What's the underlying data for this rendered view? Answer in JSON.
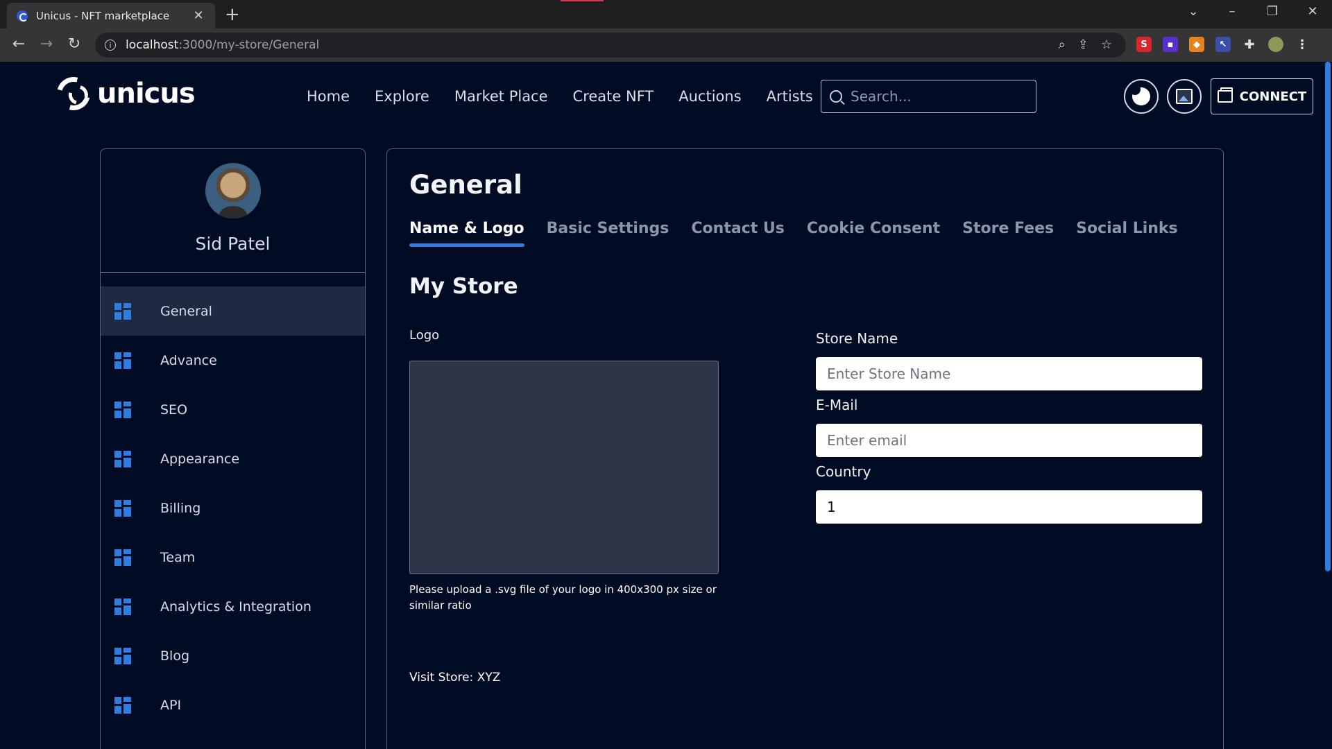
{
  "browser": {
    "tab_title": "Unicus - NFT marketplace",
    "url_host": "localhost",
    "url_path": ":3000/my-store/General"
  },
  "header": {
    "brand": "unicus",
    "nav": [
      "Home",
      "Explore",
      "Market Place",
      "Create NFT",
      "Auctions",
      "Artists"
    ],
    "search_placeholder": "Search...",
    "connect_label": "CONNECT"
  },
  "sidebar": {
    "user_name": "Sid Patel",
    "items": [
      {
        "label": "General",
        "active": true
      },
      {
        "label": "Advance"
      },
      {
        "label": "SEO"
      },
      {
        "label": "Appearance"
      },
      {
        "label": "Billing"
      },
      {
        "label": "Team"
      },
      {
        "label": "Analytics & Integration"
      },
      {
        "label": "Blog"
      },
      {
        "label": "API"
      }
    ]
  },
  "main": {
    "title": "General",
    "tabs": [
      "Name & Logo",
      "Basic Settings",
      "Contact Us",
      "Cookie Consent",
      "Store Fees",
      "Social Links"
    ],
    "section_title": "My Store",
    "logo_label": "Logo",
    "logo_help": "Please upload a .svg file of your logo in 400x300 px size or similar ratio",
    "visit_store": "Visit Store: XYZ",
    "fields": {
      "store_name_label": "Store Name",
      "store_name_placeholder": "Enter Store Name",
      "email_label": "E-Mail",
      "email_placeholder": "Enter email",
      "country_label": "Country",
      "country_value": "1"
    }
  },
  "colors": {
    "background": "#020b24",
    "accent": "#2f7de0",
    "active_item": "#1d2a42"
  }
}
